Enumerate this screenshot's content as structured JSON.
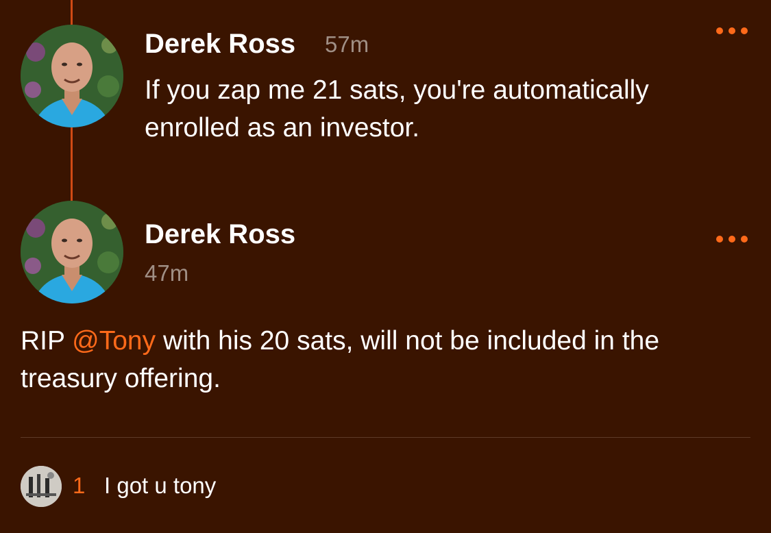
{
  "colors": {
    "background": "#3a1400",
    "accent": "#ff6a1a",
    "thread_line": "#d04a14",
    "muted": "#a08f85"
  },
  "parent_note": {
    "author": "Derek Ross",
    "time": "57m",
    "text": "If you zap me 21 sats, you're automatically enrolled as an investor."
  },
  "main_note": {
    "author": "Derek Ross",
    "time": "47m",
    "text_before_mention": "RIP ",
    "mention": "@Tony",
    "text_after_mention": " with his 20 sats, will not be included in the treasury offering."
  },
  "reply_summary": {
    "count": "1",
    "preview": "I got u tony"
  },
  "icons": {
    "more": "more-horizontal-icon"
  }
}
